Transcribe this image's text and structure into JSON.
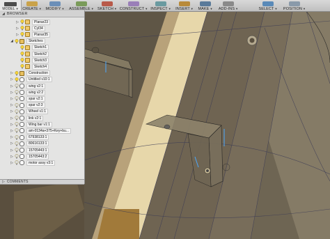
{
  "toolbar": {
    "model": "MODEL",
    "create": "CREATE",
    "modify": "MODIFY",
    "assemble": "ASSEMBLE",
    "sketch": "SKETCH",
    "construct": "CONSTRUCT",
    "inspect": "INSPECT",
    "insert": "INSERT",
    "make": "MAKE",
    "addins": "ADD-INS",
    "select": "SELECT",
    "position": "POSITION",
    "colors": {
      "create": "#c9a24a",
      "modify": "#6b8fb8",
      "assemble": "#7a9b5a",
      "sketch": "#b85a4a",
      "construct": "#9a7fb8",
      "inspect": "#6a9aa0",
      "insert": "#b88a3a",
      "make": "#5a7a9a",
      "addins": "#8a8a8a",
      "select": "#5a8ab8",
      "position": "#8a9aaa"
    }
  },
  "browser": {
    "title": "BROWSER",
    "items": [
      {
        "label": "Planar23",
        "indent": 1,
        "arrow": "▷",
        "type": "plane"
      },
      {
        "label": "Cyl34",
        "indent": 1,
        "arrow": "▷",
        "type": "plane"
      },
      {
        "label": "Planar35",
        "indent": 1,
        "arrow": "▷",
        "type": "plane"
      },
      {
        "label": "Sketches",
        "indent": 0,
        "arrow": "◢",
        "type": "folder"
      },
      {
        "label": "Sketch1",
        "indent": 1,
        "arrow": "",
        "type": "sketch"
      },
      {
        "label": "Sketch2",
        "indent": 1,
        "arrow": "",
        "type": "sketch"
      },
      {
        "label": "Sketch3",
        "indent": 1,
        "arrow": "",
        "type": "sketch"
      },
      {
        "label": "Sketch4",
        "indent": 1,
        "arrow": "",
        "type": "sketch"
      },
      {
        "label": "Construction",
        "indent": -1,
        "arrow": "▷",
        "type": "folder"
      },
      {
        "label": "Untitled v10:1",
        "indent": -1,
        "arrow": "▷",
        "type": "component"
      },
      {
        "label": "wing v2:1",
        "indent": -1,
        "arrow": "▷",
        "type": "component"
      },
      {
        "label": "wing v2:2",
        "indent": -1,
        "arrow": "▷",
        "type": "component"
      },
      {
        "label": "spar v2:1",
        "indent": -1,
        "arrow": "▷",
        "type": "component"
      },
      {
        "label": "spar v2:3",
        "indent": -1,
        "arrow": "▷",
        "type": "component"
      },
      {
        "label": "Wheel v1:1",
        "indent": -1,
        "arrow": "▷",
        "type": "component"
      },
      {
        "label": "link v2:1",
        "indent": -1,
        "arrow": "▷",
        "type": "component"
      },
      {
        "label": "Wing bar v1:1",
        "indent": -1,
        "arrow": "▷",
        "type": "component"
      },
      {
        "label": "am-0134a+375+Key+bu...",
        "indent": -1,
        "arrow": "▷",
        "type": "component"
      },
      {
        "label": "67938133:1",
        "indent": -1,
        "arrow": "▷",
        "type": "component"
      },
      {
        "label": "80616133:1",
        "indent": -1,
        "arrow": "▷",
        "type": "component"
      },
      {
        "label": "15705443:1",
        "indent": -1,
        "arrow": "▷",
        "type": "component"
      },
      {
        "label": "15705443:2",
        "indent": -1,
        "arrow": "▷",
        "type": "component"
      },
      {
        "label": "motor assy v3:1",
        "indent": -1,
        "arrow": "▷",
        "type": "component"
      }
    ]
  },
  "comments": {
    "title": "COMMENTS"
  }
}
